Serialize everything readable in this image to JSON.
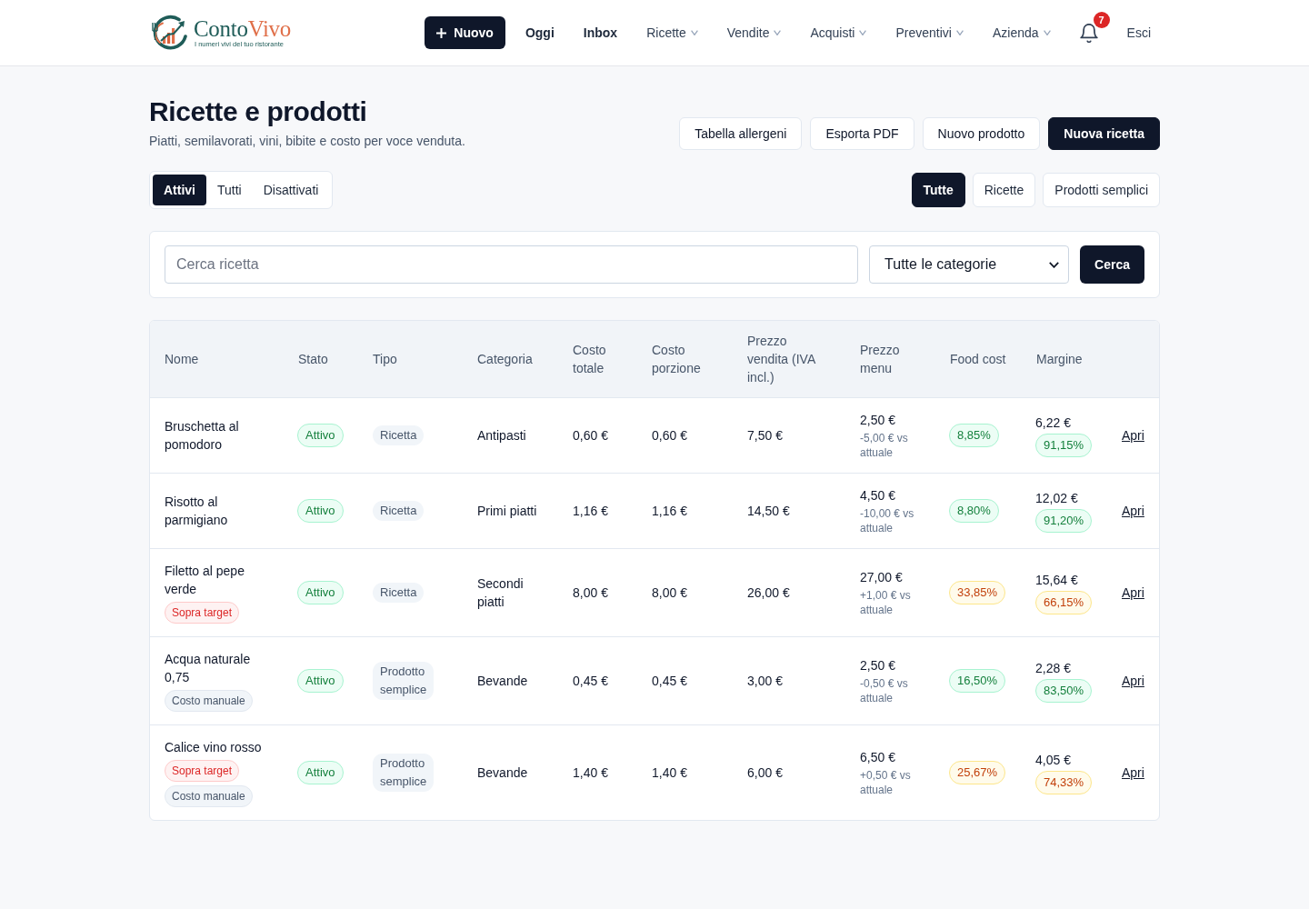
{
  "header": {
    "logo": {
      "name_first": "Conto",
      "name_second": "Vivo",
      "tagline": "I numeri vivi del tuo ristorante"
    },
    "new_button": "Nuovo",
    "nav": [
      {
        "label": "Oggi",
        "dropdown": false
      },
      {
        "label": "Inbox",
        "dropdown": false
      },
      {
        "label": "Ricette",
        "dropdown": true
      },
      {
        "label": "Vendite",
        "dropdown": true
      },
      {
        "label": "Acquisti",
        "dropdown": true
      },
      {
        "label": "Preventivi",
        "dropdown": true
      },
      {
        "label": "Azienda",
        "dropdown": true
      }
    ],
    "notifications": {
      "count": "7"
    },
    "logout": "Esci"
  },
  "page": {
    "title": "Ricette e prodotti",
    "subtitle": "Piatti, semilavorati, vini, bibite e costo per voce venduta.",
    "actions": [
      {
        "label": "Tabella allergeni",
        "kind": "outline"
      },
      {
        "label": "Esporta PDF",
        "kind": "outline"
      },
      {
        "label": "Nuovo prodotto",
        "kind": "outline"
      },
      {
        "label": "Nuova ricetta",
        "kind": "primary"
      }
    ]
  },
  "status_tabs": [
    {
      "label": "Attivi",
      "selected": true
    },
    {
      "label": "Tutti",
      "selected": false
    },
    {
      "label": "Disattivati",
      "selected": false
    }
  ],
  "type_filters": [
    {
      "label": "Tutte",
      "selected": true
    },
    {
      "label": "Ricette",
      "selected": false
    },
    {
      "label": "Prodotti semplici",
      "selected": false
    }
  ],
  "search": {
    "placeholder": "Cerca ricetta",
    "category": "Tutte le categorie",
    "button": "Cerca"
  },
  "table": {
    "columns": [
      "Nome",
      "Stato",
      "Tipo",
      "Categoria",
      "Costo totale",
      "Costo porzione",
      "Prezzo vendita (IVA incl.)",
      "Prezzo menu",
      "Food cost",
      "Margine"
    ],
    "rows": [
      {
        "name": "Bruschetta al pomodoro",
        "status": {
          "label": "Attivo",
          "active": true
        },
        "type": "Ricetta",
        "category": "Antipasti",
        "total_cost": "0,60 €",
        "portion_cost": "0,60 €",
        "sale_price": "7,50 €",
        "menu_price": "2,50 €",
        "menu_delta": "-5,00 € vs attuale",
        "food_cost": {
          "value": "8,85%",
          "warning": false
        },
        "margin": {
          "amount": "6,22 €",
          "percent": "91,15%",
          "warning": false
        },
        "action": "Apri"
      },
      {
        "name": "Risotto al parmigiano",
        "status": {
          "label": "Attivo",
          "active": true
        },
        "type": "Ricetta",
        "category": "Primi piatti",
        "total_cost": "1,16 €",
        "portion_cost": "1,16 €",
        "sale_price": "14,50 €",
        "menu_price": "4,50 €",
        "menu_delta": "-10,00 € vs attuale",
        "food_cost": {
          "value": "8,80%",
          "warning": false
        },
        "margin": {
          "amount": "12,02 €",
          "percent": "91,20%",
          "warning": false
        },
        "action": "Apri"
      },
      {
        "name": "Filetto al pepe verde",
        "tags": [
          {
            "label": "Sopra target",
            "kind": "alert"
          }
        ],
        "status": {
          "label": "Attivo",
          "active": true
        },
        "type": "Ricetta",
        "category": "Secondi piatti",
        "total_cost": "8,00 €",
        "portion_cost": "8,00 €",
        "sale_price": "26,00 €",
        "menu_price": "27,00 €",
        "menu_delta": "+1,00 € vs attuale",
        "food_cost": {
          "value": "33,85%",
          "warning": true
        },
        "margin": {
          "amount": "15,64 €",
          "percent": "66,15%",
          "warning": true
        },
        "action": "Apri"
      },
      {
        "name": "Acqua naturale 0,75",
        "tags": [
          {
            "label": "Costo manuale",
            "kind": "neutral"
          }
        ],
        "status": {
          "label": "Attivo",
          "active": true
        },
        "type": "Prodotto semplice",
        "category": "Bevande",
        "total_cost": "0,45 €",
        "portion_cost": "0,45 €",
        "sale_price": "3,00 €",
        "menu_price": "2,50 €",
        "menu_delta": "-0,50 € vs attuale",
        "food_cost": {
          "value": "16,50%",
          "warning": false
        },
        "margin": {
          "amount": "2,28 €",
          "percent": "83,50%",
          "warning": false
        },
        "action": "Apri"
      },
      {
        "name": "Calice vino rosso",
        "tags": [
          {
            "label": "Sopra target",
            "kind": "alert"
          },
          {
            "label": "Costo manuale",
            "kind": "neutral"
          }
        ],
        "status": {
          "label": "Attivo",
          "active": true
        },
        "type": "Prodotto semplice",
        "category": "Bevande",
        "total_cost": "1,40 €",
        "portion_cost": "1,40 €",
        "sale_price": "6,00 €",
        "menu_price": "6,50 €",
        "menu_delta": "+0,50 € vs attuale",
        "food_cost": {
          "value": "25,67%",
          "warning": true
        },
        "margin": {
          "amount": "4,05 €",
          "percent": "74,33%",
          "warning": true
        },
        "action": "Apri"
      }
    ]
  }
}
